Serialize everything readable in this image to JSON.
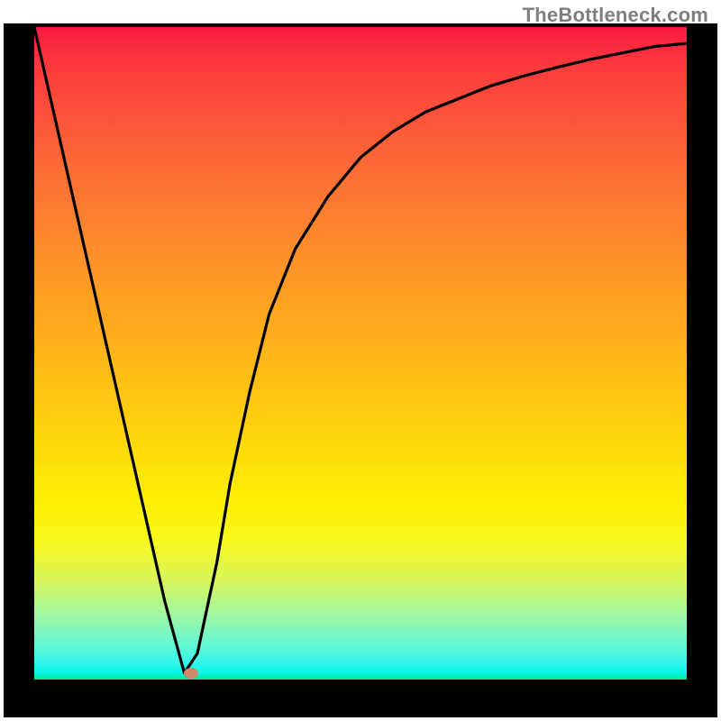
{
  "watermark": "TheBottleneck.com",
  "chart_data": {
    "type": "line",
    "title": "",
    "xlabel": "",
    "ylabel": "",
    "xlim": [
      0,
      100
    ],
    "ylim": [
      0,
      100
    ],
    "series": [
      {
        "name": "curve",
        "x": [
          0,
          5,
          10,
          15,
          20,
          23,
          25,
          28,
          30,
          33,
          36,
          40,
          45,
          50,
          55,
          60,
          65,
          70,
          75,
          80,
          85,
          90,
          95,
          100
        ],
        "y": [
          100,
          78,
          56,
          34,
          12,
          1,
          4,
          18,
          30,
          44,
          56,
          66,
          74,
          80,
          84,
          87,
          89,
          91,
          92.5,
          93.8,
          95,
          96,
          97,
          97.5
        ]
      }
    ],
    "marker": {
      "x": 24,
      "y": 1
    }
  },
  "colors": {
    "frame": "#000000",
    "curve": "#000000",
    "marker": "#cf866b"
  }
}
